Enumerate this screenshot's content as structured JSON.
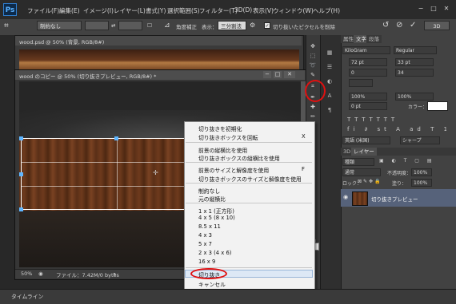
{
  "app": {
    "logo": "Ps"
  },
  "menu": [
    "ファイル(F)",
    "編集(E)",
    "イメージ(I)",
    "レイヤー(L)",
    "書式(Y)",
    "選択範囲(S)",
    "フィルター(T)",
    "3D(D)",
    "表示(V)",
    "ウィンドウ(W)",
    "ヘルプ(H)"
  ],
  "options": {
    "preset": "制約なし",
    "straighten_label": "角度補正",
    "view_label": "表示：",
    "view_value": "三分割法",
    "delete_pixels_label": "切り抜いたピクセルを削除",
    "workspace_label": "3D"
  },
  "doc1": {
    "title": "wood.psd @ 50% (背景, RGB/8#)"
  },
  "doc2": {
    "title": "wood のコピー @ 50% (切り抜きプレビュー, RGB/8#) *",
    "zoom": "50%",
    "file_info": "ファイル：7.42M/0 bytes"
  },
  "panels": {
    "tabs": [
      "属性",
      "文字",
      "段落"
    ],
    "font": "KiloGram",
    "style": "Regular",
    "size": "72 pt",
    "leading": "33 pt",
    "tracking": "0",
    "kerning": "34",
    "vscale": "100%",
    "hscale": "100%",
    "baseline": "0 pt",
    "color_label": "カラー：",
    "lang": "英語 (米国)",
    "aa": "シャープ",
    "layers_tabs": [
      "3D",
      "レイヤー"
    ],
    "kind_label": "種類",
    "blend": "通常",
    "opacity_label": "不透明度：",
    "opacity": "100%",
    "lock_label": "ロック：",
    "fill_label": "塗り：",
    "fill": "100%",
    "layer_name": "切り抜きプレビュー"
  },
  "context_menu": {
    "items": [
      {
        "label": "切り抜きを初期化",
        "key": ""
      },
      {
        "label": "切り抜きボックスを回転",
        "key": "X"
      },
      {
        "label": "前景の縦横比を使用",
        "key": ""
      },
      {
        "label": "切り抜きボックスの縦横比を使用",
        "key": ""
      },
      {
        "label": "前景のサイズと解像度を使用",
        "key": "F"
      },
      {
        "label": "切り抜きボックスのサイズと解像度を使用",
        "key": ""
      },
      {
        "label": "制約なし",
        "key": ""
      },
      {
        "label": "元の縦横比",
        "key": ""
      },
      {
        "label": "1 x 1 (正方形)",
        "key": ""
      },
      {
        "label": "4 x 5 (8 x 10)",
        "key": ""
      },
      {
        "label": "8.5 x 11",
        "key": ""
      },
      {
        "label": "4 x 3",
        "key": ""
      },
      {
        "label": "5 x 7",
        "key": ""
      },
      {
        "label": "2 x 3 (4 x 6)",
        "key": ""
      },
      {
        "label": "16 x 9",
        "key": ""
      },
      {
        "label": "切り抜き",
        "key": ""
      },
      {
        "label": "キャンセル",
        "key": ""
      }
    ]
  },
  "bottom": {
    "timeline": "タイムライン"
  },
  "colors": {
    "annotation": "#e01010",
    "accent": "#5fb6ff"
  }
}
